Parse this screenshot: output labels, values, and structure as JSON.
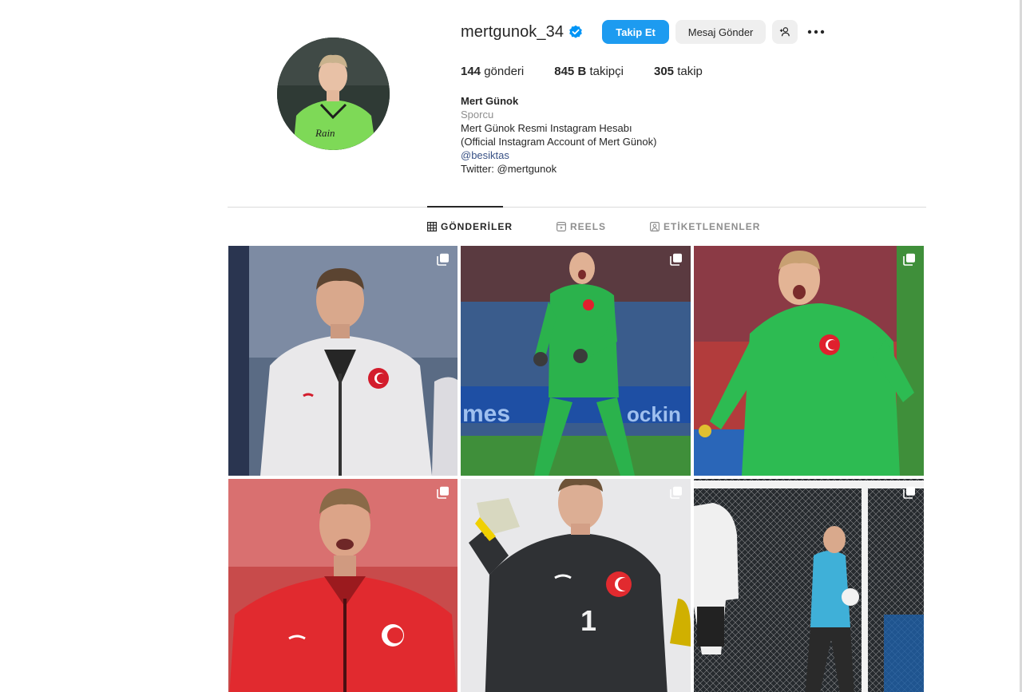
{
  "profile": {
    "username": "mertgunok_34",
    "follow_label": "Takip Et",
    "message_label": "Mesaj Gönder",
    "stats": {
      "posts_count": "144",
      "posts_label": "gönderi",
      "followers_count": "845 B",
      "followers_label": "takipçi",
      "following_count": "305",
      "following_label": "takip"
    },
    "bio": {
      "name": "Mert Günok",
      "category": "Sporcu",
      "line1": "Mert Günok Resmi Instagram Hesabı",
      "line2": "(Official Instagram Account of Mert Günok)",
      "mention": "@besiktas",
      "twitter": "Twitter: @mertgunok"
    }
  },
  "tabs": [
    {
      "label": "GÖNDERİLER",
      "icon": "grid-icon",
      "active": true
    },
    {
      "label": "REELS",
      "icon": "reels-icon",
      "active": false
    },
    {
      "label": "ETİKETLENENLER",
      "icon": "tagged-icon",
      "active": false
    }
  ],
  "posts": [
    {
      "subject": "goalkeeper in white jacket",
      "multi": true
    },
    {
      "subject": "goalkeeper in green kit celebrating",
      "multi": true
    },
    {
      "subject": "goalkeeper in green kit shouting",
      "multi": true
    },
    {
      "subject": "goalkeeper in red jacket",
      "multi": true
    },
    {
      "subject": "goalkeeper in black kit with gloves",
      "multi": true
    },
    {
      "subject": "goalkeeper training at goal",
      "multi": true
    }
  ],
  "colors": {
    "accent": "#1d9bf0",
    "verified": "#0095f6",
    "link": "#385185",
    "muted": "#8e8e8e"
  }
}
